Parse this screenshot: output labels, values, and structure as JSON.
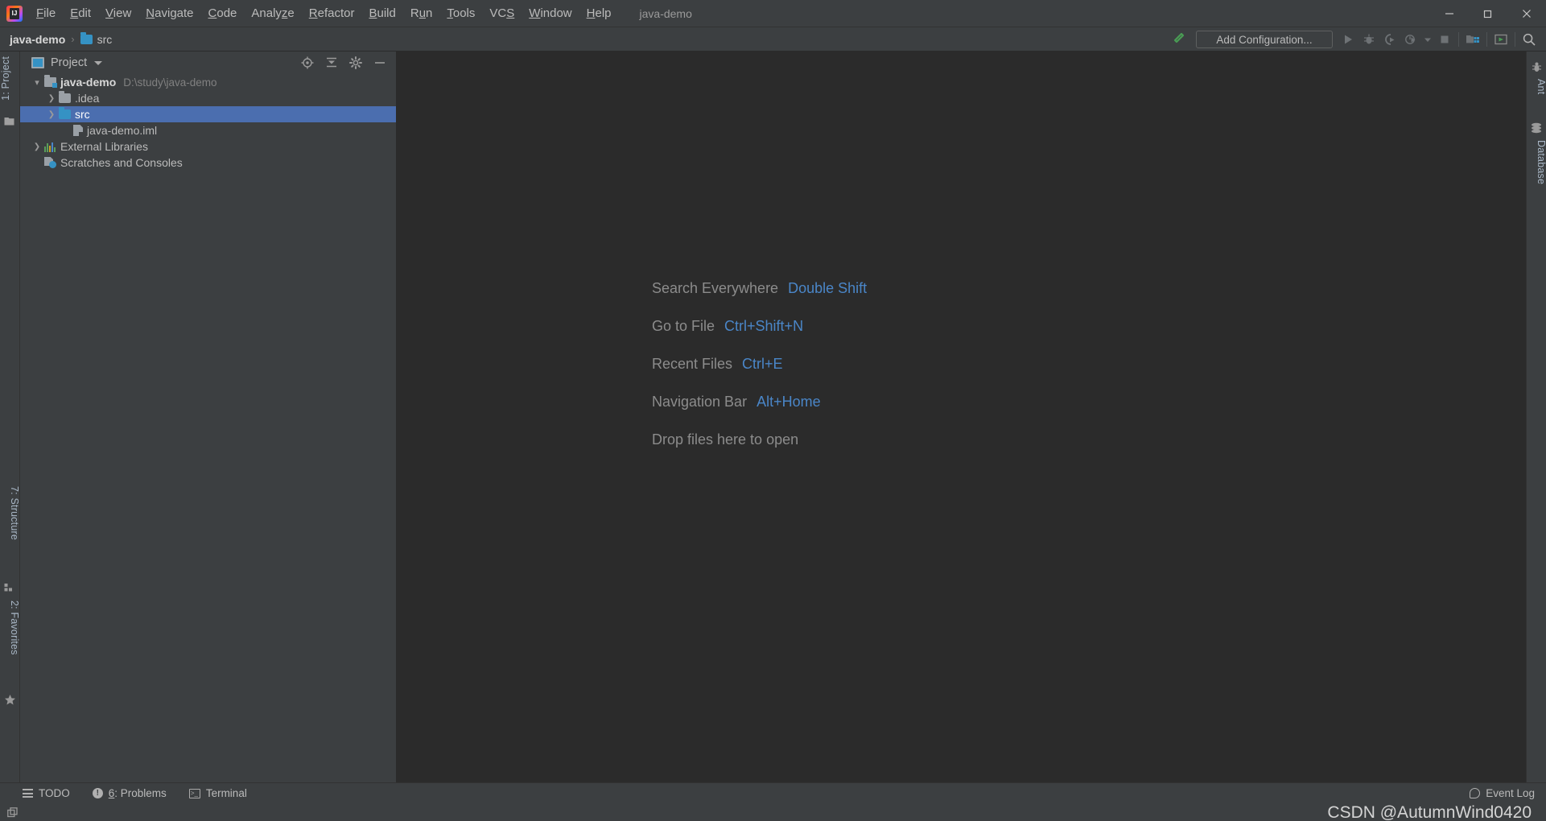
{
  "window": {
    "title": "java-demo",
    "controls": [
      {
        "name": "minimize",
        "glyph": "—"
      },
      {
        "name": "maximize",
        "glyph": "❐"
      },
      {
        "name": "close",
        "glyph": "✕"
      }
    ]
  },
  "menubar": {
    "items": [
      {
        "label": "File",
        "mnemonic": "F"
      },
      {
        "label": "Edit",
        "mnemonic": "E"
      },
      {
        "label": "View",
        "mnemonic": "V"
      },
      {
        "label": "Navigate",
        "mnemonic": "N"
      },
      {
        "label": "Code",
        "mnemonic": "C"
      },
      {
        "label": "Analyze",
        "mnemonic": "z"
      },
      {
        "label": "Refactor",
        "mnemonic": "R"
      },
      {
        "label": "Build",
        "mnemonic": "B"
      },
      {
        "label": "Run",
        "mnemonic": "u"
      },
      {
        "label": "Tools",
        "mnemonic": "T"
      },
      {
        "label": "VCS",
        "mnemonic": "S"
      },
      {
        "label": "Window",
        "mnemonic": "W"
      },
      {
        "label": "Help",
        "mnemonic": "H"
      }
    ]
  },
  "navbar": {
    "breadcrumb": [
      "java-demo",
      "src"
    ],
    "separator": "›",
    "run_configuration": "Add Configuration...",
    "toolbar_icons": [
      "run-icon",
      "debug-icon",
      "run-with-coverage-icon",
      "profiler-icon",
      "profiler-dropdown-icon",
      "stop-icon",
      "project-structure-icon",
      "select-in-icon",
      "search-icon"
    ]
  },
  "left_tool_strip": {
    "top": [
      {
        "label": "1: Project",
        "icon": "project-icon"
      }
    ],
    "bottom": [
      {
        "label": "7: Structure",
        "icon": "structure-icon"
      },
      {
        "label": "2: Favorites",
        "icon": "star-icon"
      }
    ]
  },
  "right_tool_strip": {
    "items": [
      {
        "label": "Ant",
        "icon": "ant-icon"
      },
      {
        "label": "Database",
        "icon": "database-icon"
      }
    ]
  },
  "project_panel": {
    "title": "Project",
    "actions": [
      "locate-icon",
      "collapse-all-icon",
      "settings-icon",
      "hide-icon"
    ],
    "tree": [
      {
        "label": "java-demo",
        "path": "D:\\study\\java-demo",
        "icon": "module-folder-icon",
        "indent": 0,
        "arrow": "down",
        "bold": true,
        "selected": false
      },
      {
        "label": ".idea",
        "path": "",
        "icon": "folder-gray-icon",
        "indent": 1,
        "arrow": "right",
        "bold": false,
        "selected": false
      },
      {
        "label": "src",
        "path": "",
        "icon": "folder-blue-icon",
        "indent": 1,
        "arrow": "right",
        "bold": false,
        "selected": true
      },
      {
        "label": "java-demo.iml",
        "path": "",
        "icon": "iml-file-icon",
        "indent": 2,
        "arrow": "none",
        "bold": false,
        "selected": false
      },
      {
        "label": "External Libraries",
        "path": "",
        "icon": "library-icon",
        "indent": 0,
        "arrow": "right",
        "bold": false,
        "selected": false
      },
      {
        "label": "Scratches and Consoles",
        "path": "",
        "icon": "scratch-icon",
        "indent": 0,
        "arrow": "none",
        "bold": false,
        "selected": false
      }
    ]
  },
  "editor": {
    "hints": [
      {
        "label": "Search Everywhere",
        "key": "Double Shift"
      },
      {
        "label": "Go to File",
        "key": "Ctrl+Shift+N"
      },
      {
        "label": "Recent Files",
        "key": "Ctrl+E"
      },
      {
        "label": "Navigation Bar",
        "key": "Alt+Home"
      },
      {
        "label": "Drop files here to open",
        "key": ""
      }
    ]
  },
  "statusbar": {
    "left": [
      {
        "label": "TODO",
        "icon": "todo-icon",
        "mnemonic": ""
      },
      {
        "label": "6: Problems",
        "icon": "problems-icon",
        "mnemonic": "6"
      },
      {
        "label": "Terminal",
        "icon": "terminal-icon",
        "mnemonic": ""
      }
    ],
    "right": {
      "label": "Event Log",
      "icon": "event-log-icon"
    }
  },
  "watermark": "CSDN @AutumnWind0420",
  "colors": {
    "accent_blue": "#4a86c8",
    "selection_blue": "#4b6eaf",
    "folder_blue": "#3592c4",
    "editor_bg": "#2b2b2b",
    "chrome_bg": "#3c3f41",
    "text": "#bbbbbb"
  }
}
